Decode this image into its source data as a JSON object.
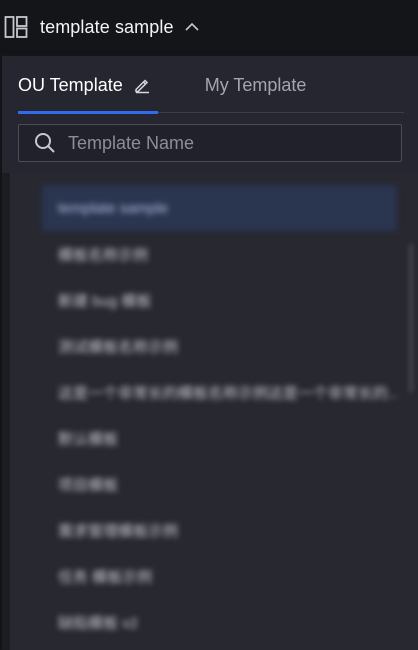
{
  "header": {
    "title": "template sample",
    "layout_icon": "layout-grid-icon",
    "chevron_icon": "chevron-up-icon"
  },
  "tabs": [
    {
      "label": "OU Template",
      "active": true,
      "icon": "edit-pencil-icon"
    },
    {
      "label": "My Template",
      "active": false
    }
  ],
  "search": {
    "placeholder": "Template Name",
    "value": "",
    "icon": "search-icon"
  },
  "list": {
    "items": [
      {
        "label": "template sample",
        "selected": true
      },
      {
        "label": "模板名称示例",
        "selected": false
      },
      {
        "label": "新建 bug 模板",
        "selected": false
      },
      {
        "label": "测试模板名称示例",
        "selected": false
      },
      {
        "label": "这是一个非常长的模板名称示例这是一个非常长的…",
        "selected": false
      },
      {
        "label": "默认模板",
        "selected": false
      },
      {
        "label": "项目模板",
        "selected": false
      },
      {
        "label": "需求管理模板示例",
        "selected": false
      },
      {
        "label": "任务 模板示例",
        "selected": false
      },
      {
        "label": "缺陷模板 v2",
        "selected": false
      }
    ]
  },
  "colors": {
    "accent": "#2f6cf0",
    "panel_bg": "#25262f",
    "topbar_bg": "#141519"
  }
}
